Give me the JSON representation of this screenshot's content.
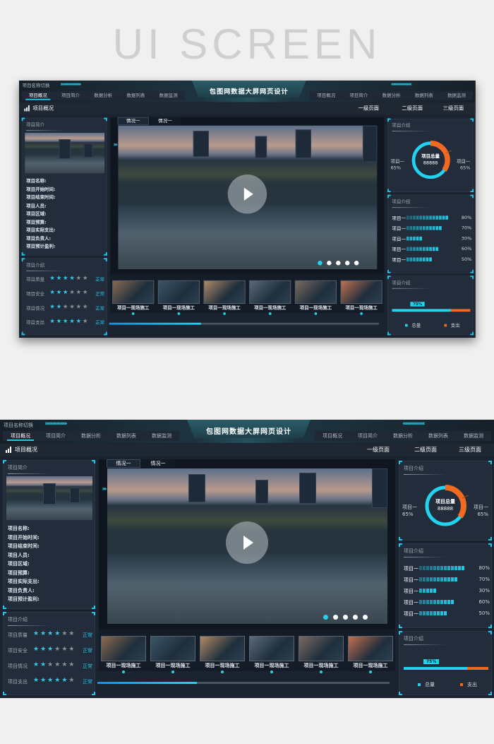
{
  "banner": "UI SCREEN",
  "header": {
    "switch_label": "项目名称切换",
    "title": "包图网数据大屏网页设计",
    "left_tabs": [
      "项目概况",
      "项目简介",
      "数据分析",
      "数据列表",
      "数据监测"
    ],
    "right_tabs": [
      "项目概况",
      "项目简介",
      "数据分析",
      "数据列表",
      "数据监测"
    ],
    "active_tab": 0
  },
  "subheader": {
    "section": "项目概况",
    "pages": [
      "一级页面",
      "二级页面",
      "三级页面"
    ]
  },
  "left": {
    "intro_title": "项目简介",
    "fields": [
      "项目名称:",
      "项目开始时间:",
      "项目结束时间:",
      "项目人员:",
      "项目区域:",
      "项目预算:",
      "项目实际支出:",
      "项目负责人:",
      "项目预计盈利:"
    ],
    "rating_title": "项目介绍",
    "ratings": [
      {
        "label": "项目质量",
        "stars": 4,
        "max": 6,
        "status": "正常"
      },
      {
        "label": "项目安全",
        "stars": 3,
        "max": 6,
        "status": "正常"
      },
      {
        "label": "项目情况",
        "stars": 2,
        "max": 6,
        "status": "正常"
      },
      {
        "label": "项目支出",
        "stars": 5,
        "max": 6,
        "status": "正常"
      }
    ]
  },
  "center": {
    "tabs": [
      "情况一",
      "情况一"
    ],
    "carousel_dots": 5,
    "carousel_active": 0,
    "thumbs": [
      "项目一现场施工",
      "项目一现场施工",
      "项目一现场施工",
      "项目一现场施工",
      "项目一现场施工",
      "项目一现场施工"
    ],
    "scroll_progress": 34
  },
  "right": {
    "donut": {
      "title": "项目介绍",
      "center_label": "项目总量",
      "center_value": "88888",
      "left_label": "项目一",
      "left_value": "65%",
      "right_label": "项目一",
      "right_value": "65%",
      "orange_share": 35,
      "colors": {
        "cyan": "#22d3f0",
        "orange": "#f26a22"
      }
    },
    "bars": {
      "title": "项目介绍",
      "items": [
        {
          "label": "项目一",
          "value": 80,
          "text": "80%"
        },
        {
          "label": "项目一",
          "value": 70,
          "text": "70%"
        },
        {
          "label": "项目一",
          "value": 30,
          "text": "30%"
        },
        {
          "label": "项目一",
          "value": 60,
          "text": "60%"
        },
        {
          "label": "项目一",
          "value": 50,
          "text": "50%"
        }
      ]
    },
    "progress": {
      "title": "项目介绍",
      "value": 75,
      "text": "75%",
      "legend": [
        "总量",
        "支出"
      ]
    }
  },
  "colors": {
    "accent": "#22c6e8",
    "orange": "#f26a22",
    "bg": "#1b2330"
  }
}
